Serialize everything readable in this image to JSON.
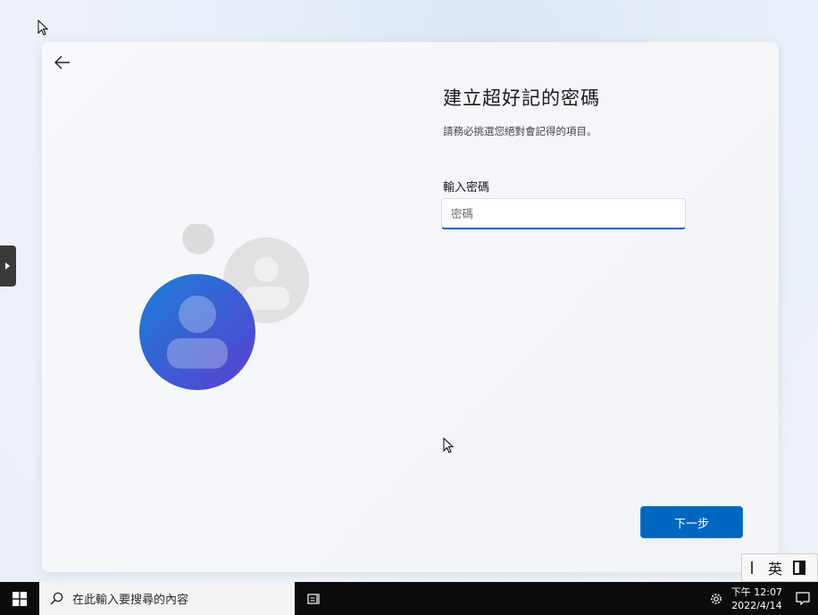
{
  "setup": {
    "title": "建立超好記的密碼",
    "subtitle": "請務必挑選您絕對會記得的項目。",
    "password_label": "輸入密碼",
    "password_placeholder": "密碼",
    "password_value": "",
    "next_label": "下一步"
  },
  "ime": {
    "mode": "英"
  },
  "taskbar": {
    "search_placeholder": "在此輸入要搜尋的內容",
    "time": "下午 12:07",
    "date": "2022/4/14"
  },
  "colors": {
    "accent": "#0067c0",
    "taskbar": "#0c0c0c"
  }
}
